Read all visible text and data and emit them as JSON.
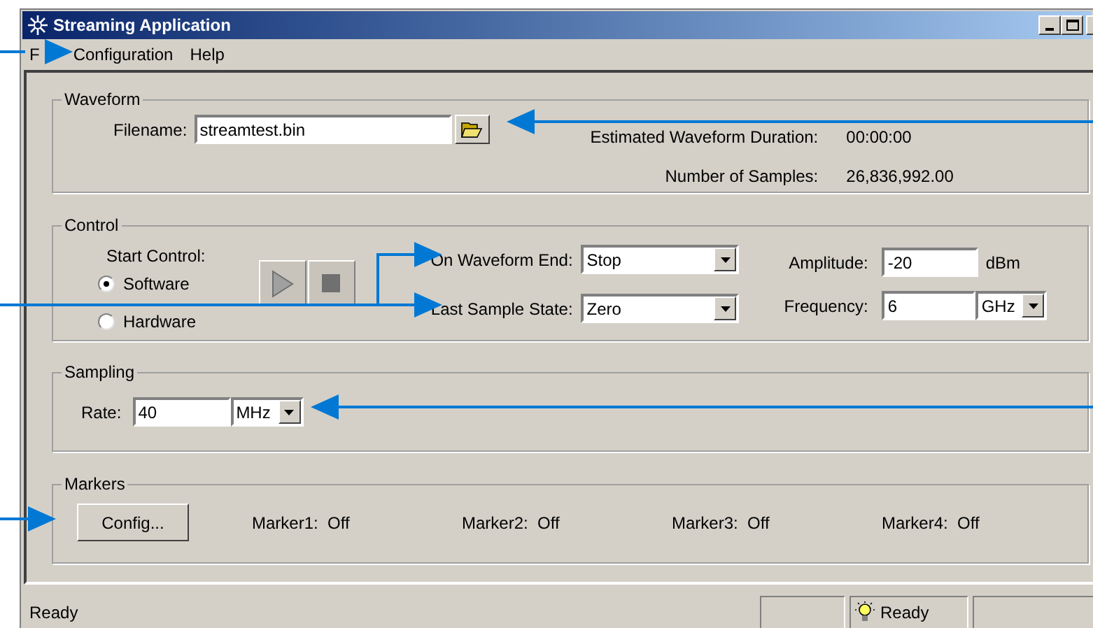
{
  "window": {
    "title": "Streaming Application"
  },
  "menu": [
    {
      "label": "F"
    },
    {
      "label": "Configuration"
    },
    {
      "label": "Help"
    }
  ],
  "waveform": {
    "title": "Waveform",
    "filename_label": "Filename:",
    "filename": "streamtest.bin",
    "info": [
      {
        "label": "Estimated Waveform Duration:",
        "value": "00:00:00"
      },
      {
        "label": "Number of Samples:",
        "value": "26,836,992.00"
      }
    ]
  },
  "control": {
    "title": "Control",
    "start_label": "Start Control:",
    "start_options": [
      {
        "label": "Software",
        "selected": true
      },
      {
        "label": "Hardware",
        "selected": false
      }
    ],
    "on_end": {
      "label": "On Waveform End:",
      "value": "Stop"
    },
    "last_state": {
      "label": "Last Sample State:",
      "value": "Zero"
    },
    "amplitude": {
      "label": "Amplitude:",
      "value": "-20",
      "unit": "dBm"
    },
    "frequency": {
      "label": "Frequency:",
      "value": "6",
      "unit": "GHz"
    }
  },
  "sampling": {
    "title": "Sampling",
    "rate_label": "Rate:",
    "rate": "40",
    "unit": "MHz"
  },
  "markers": {
    "title": "Markers",
    "button": "Config...",
    "items": [
      {
        "label": "Marker1:",
        "value": "Off"
      },
      {
        "label": "Marker2:",
        "value": "Off"
      },
      {
        "label": "Marker3:",
        "value": "Off"
      },
      {
        "label": "Marker4:",
        "value": "Off"
      }
    ]
  },
  "status_bar": {
    "message": "Ready",
    "indicator": "Ready"
  }
}
